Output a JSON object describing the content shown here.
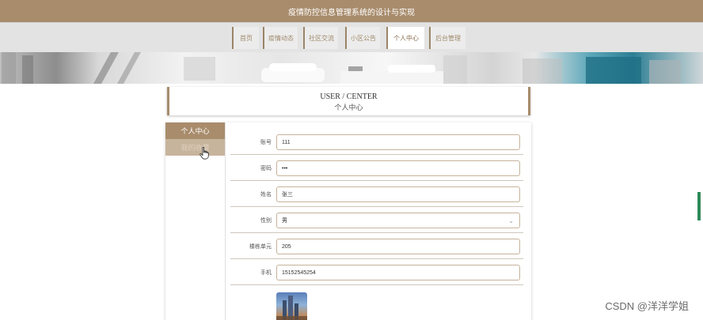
{
  "header": {
    "title": "疫情防控信息管理系统的设计与实现"
  },
  "nav": {
    "items": [
      {
        "label": "首页"
      },
      {
        "label": "疫情动态"
      },
      {
        "label": "社区交流"
      },
      {
        "label": "小区公告"
      },
      {
        "label": "个人中心"
      },
      {
        "label": "后台管理"
      }
    ],
    "active": "个人中心"
  },
  "section": {
    "title_en": "USER / CENTER",
    "title_cn": "个人中心"
  },
  "sidebar": {
    "items": [
      {
        "label": "个人中心"
      },
      {
        "label": "我的收藏"
      }
    ]
  },
  "form": {
    "account_label": "账号",
    "account_value": "111",
    "password_label": "密码",
    "password_value": "•••",
    "name_label": "姓名",
    "name_value": "张三",
    "gender_label": "性别",
    "gender_value": "男",
    "unit_label": "楼栋单元",
    "unit_value": "205",
    "phone_label": "手机",
    "phone_value": "15152545254"
  },
  "watermark": "CSDN @洋洋学姐",
  "colors": {
    "brand": "#a88c6c",
    "nav_bg": "#e3e3e3",
    "input_border": "#c6b39a"
  },
  "icons": {
    "select": "chevron-down-icon",
    "cursor": "hand-pointer-icon"
  }
}
